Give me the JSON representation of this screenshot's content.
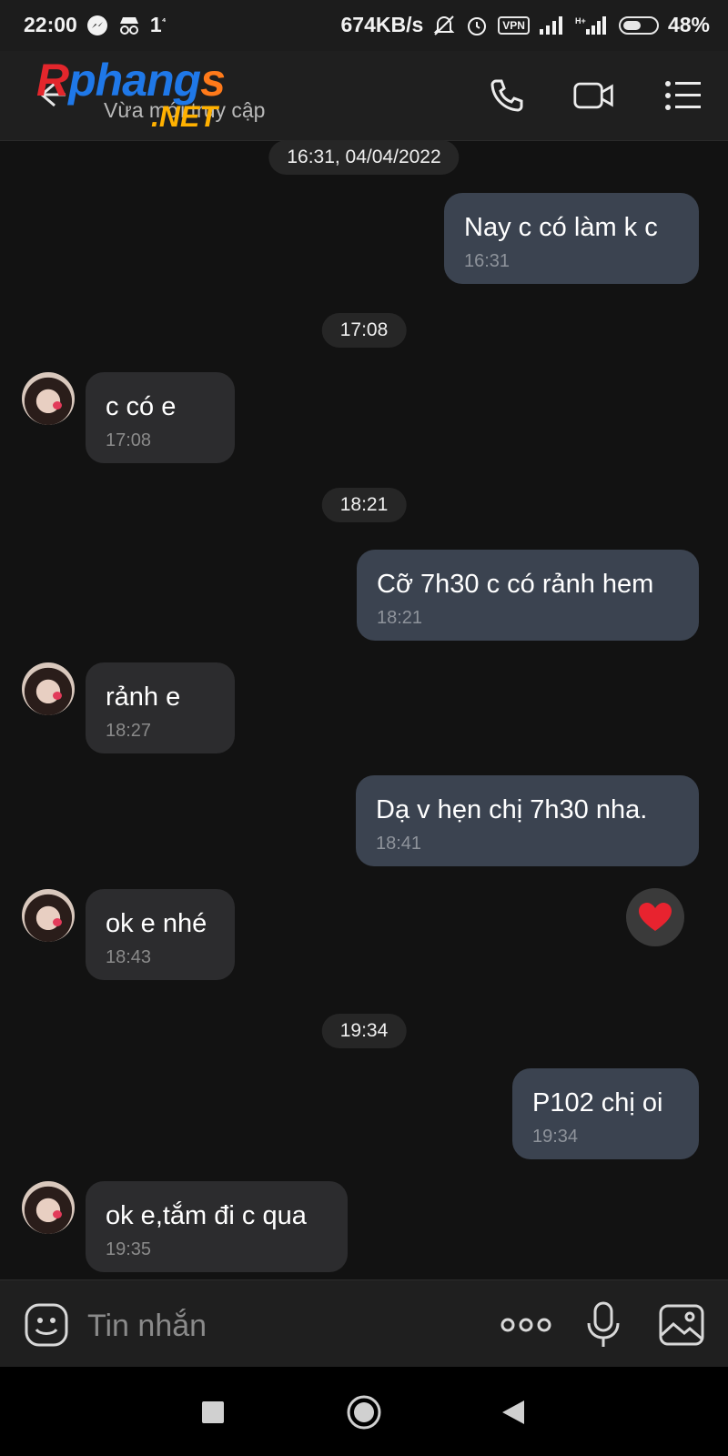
{
  "status_bar": {
    "time": "22:00",
    "notif_count": "1",
    "notif_sup": "⁴",
    "net_speed": "674KB/s",
    "vpn": "VPN",
    "battery": "48%",
    "battery_level": 0.48
  },
  "header": {
    "logo_part1": "R",
    "logo_part2": "phang",
    "logo_part3": "s",
    "logo_net": ".NET",
    "subtitle": "Vừa mới truy cập"
  },
  "chat": {
    "messages": [
      {
        "type": "divider",
        "text": "16:31, 04/04/2022"
      },
      {
        "type": "out",
        "text": "Nay c có làm k c",
        "time": "16:31"
      },
      {
        "type": "divider",
        "text": "17:08"
      },
      {
        "type": "in",
        "text": "c có e",
        "time": "17:08"
      },
      {
        "type": "divider",
        "text": "18:21"
      },
      {
        "type": "out",
        "text": "Cỡ 7h30 c có rảnh hem",
        "time": "18:21"
      },
      {
        "type": "in",
        "text": "rảnh e",
        "time": "18:27"
      },
      {
        "type": "out",
        "text": "Dạ v hẹn chị 7h30 nha.",
        "time": "18:41"
      },
      {
        "type": "in",
        "text": "ok e nhé",
        "time": "18:43"
      },
      {
        "type": "divider",
        "text": "19:34"
      },
      {
        "type": "out",
        "text": "P102 chị oi",
        "time": "19:34"
      },
      {
        "type": "in",
        "text": "ok e,tắm đi c qua",
        "time": "19:35"
      }
    ],
    "reaction": "❤️"
  },
  "input": {
    "placeholder": "Tin nhắn"
  },
  "colors": {
    "background": "#121212",
    "outgoing_bubble": "#3b4350",
    "incoming_bubble": "#2c2c2e"
  }
}
